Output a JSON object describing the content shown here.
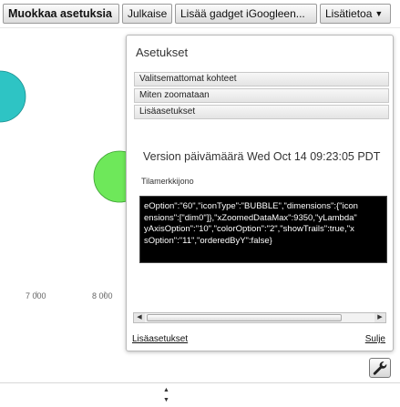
{
  "toolbar": {
    "edit_settings": "Muokkaa asetuksia",
    "publish": "Julkaise",
    "add_igoogle": "Lisää gadget iGoogleen...",
    "more_info": "Lisätietoa"
  },
  "chart": {
    "x_ticks": [
      "7 000",
      "8 000"
    ],
    "bubble_colors": [
      "#2ec4c4",
      "#6ee85a"
    ]
  },
  "settings_panel": {
    "title": "Asetukset",
    "sections": [
      "Valitsemattomat kohteet",
      "Miten zoomataan",
      "Lisäasetukset"
    ],
    "version_text": "Version päivämäärä Wed Oct 14 09:23:05 PDT",
    "state_label": "Tilamerkkijono",
    "state_lines": [
      "eOption\":\"60\",\"iconType\":\"BUBBLE\",\"dimensions\":{\"icon",
      "ensions\":[\"dim0\"]},\"xZoomedDataMax\":9350,\"yLambda\"",
      "yAxisOption\":\"10\",\"colorOption\":\"2\",\"showTrails\":true,\"x",
      "sOption\":\"11\",\"orderedByY\":false}"
    ],
    "advanced_link": "Lisäasetukset",
    "close_link": "Sulje"
  },
  "icons": {
    "wrench": "wrench-icon",
    "dropdown": "chevron-down-icon"
  }
}
